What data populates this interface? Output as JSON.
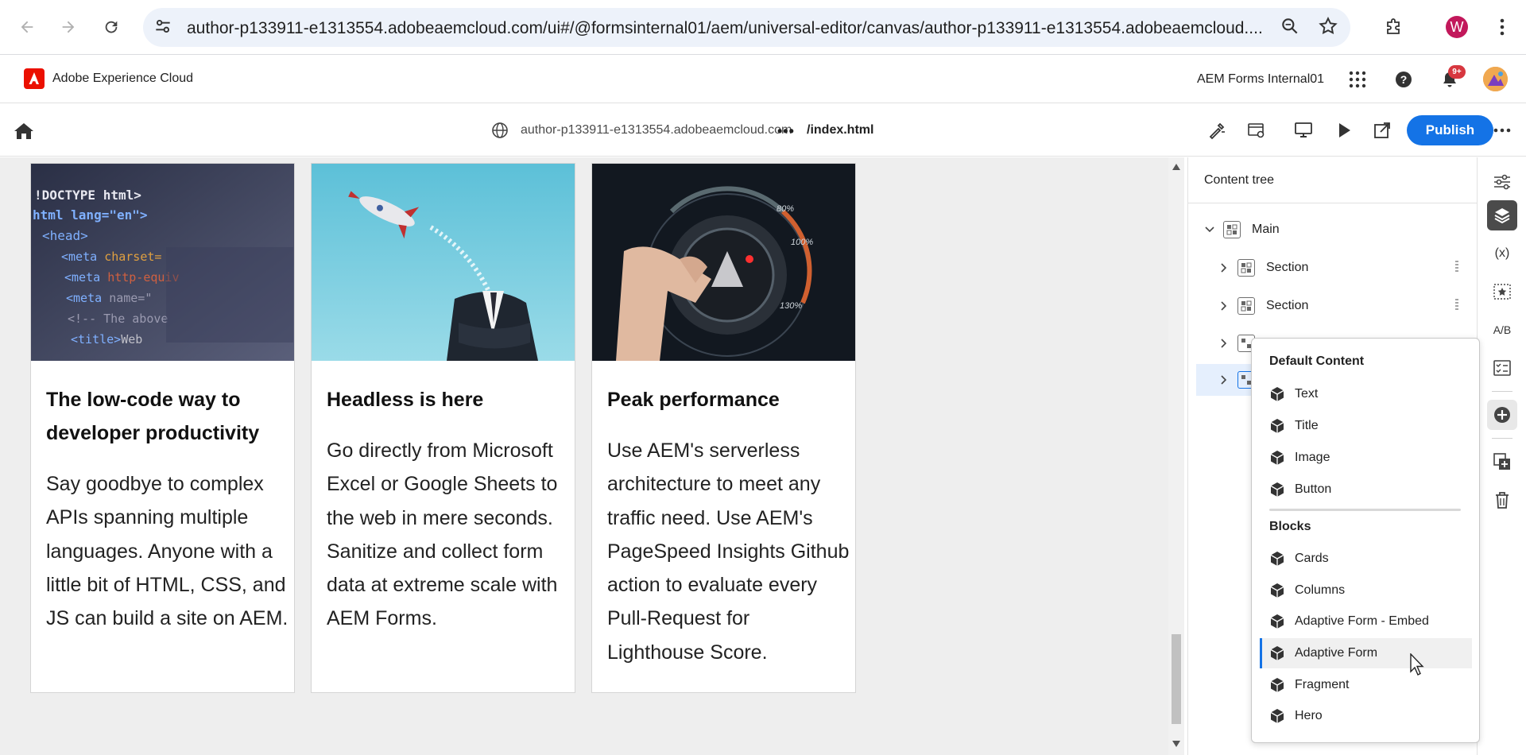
{
  "browser": {
    "url": "author-p133911-e1313554.adobeaemcloud.com/ui#/@formsinternal01/aem/universal-editor/canvas/author-p133911-e1313554.adobeaemcloud....",
    "profile_initial": "W"
  },
  "shell": {
    "title": "Adobe Experience Cloud",
    "org": "AEM Forms Internal01",
    "notification_count": "9+"
  },
  "editor": {
    "site_url": "author-p133911-e1313554.adobeaemcloud.com",
    "more": "•••",
    "page_path": "/index.html",
    "publish_label": "Publish"
  },
  "cards": [
    {
      "title": "The low-code way to developer productivity",
      "body": "Say goodbye to complex APIs spanning multiple languages. Anyone with a little bit of HTML, CSS, and JS can build a site on AEM.",
      "image": "code-editor-image"
    },
    {
      "title": "Headless is here",
      "body": "Go directly from Microsoft Excel or Google Sheets to the web in mere seconds. Sanitize and collect form data at extreme scale with AEM Forms.",
      "image": "rocket-businessman-image"
    },
    {
      "title": "Peak performance",
      "body": "Use AEM's serverless architecture to meet any traffic need. Use AEM's PageSpeed Insights Github action to evaluate every Pull-Request for Lighthouse Score.",
      "image": "speedometer-image"
    }
  ],
  "content_tree": {
    "title": "Content tree",
    "nodes": [
      {
        "label": "Main"
      },
      {
        "label": "Section"
      },
      {
        "label": "Section"
      }
    ]
  },
  "add_menu": {
    "default_heading": "Default Content",
    "default_items": [
      "Text",
      "Title",
      "Image",
      "Button"
    ],
    "blocks_heading": "Blocks",
    "block_items": [
      "Cards",
      "Columns",
      "Adaptive Form - Embed",
      "Adaptive Form",
      "Fragment",
      "Hero"
    ],
    "highlighted": "Adaptive Form"
  },
  "rail": {
    "variables_label": "(x)",
    "ab_label": "A/B"
  },
  "colors": {
    "accent": "#1473e6",
    "adobe_red": "#eb1000",
    "badge": "#d7373f"
  }
}
